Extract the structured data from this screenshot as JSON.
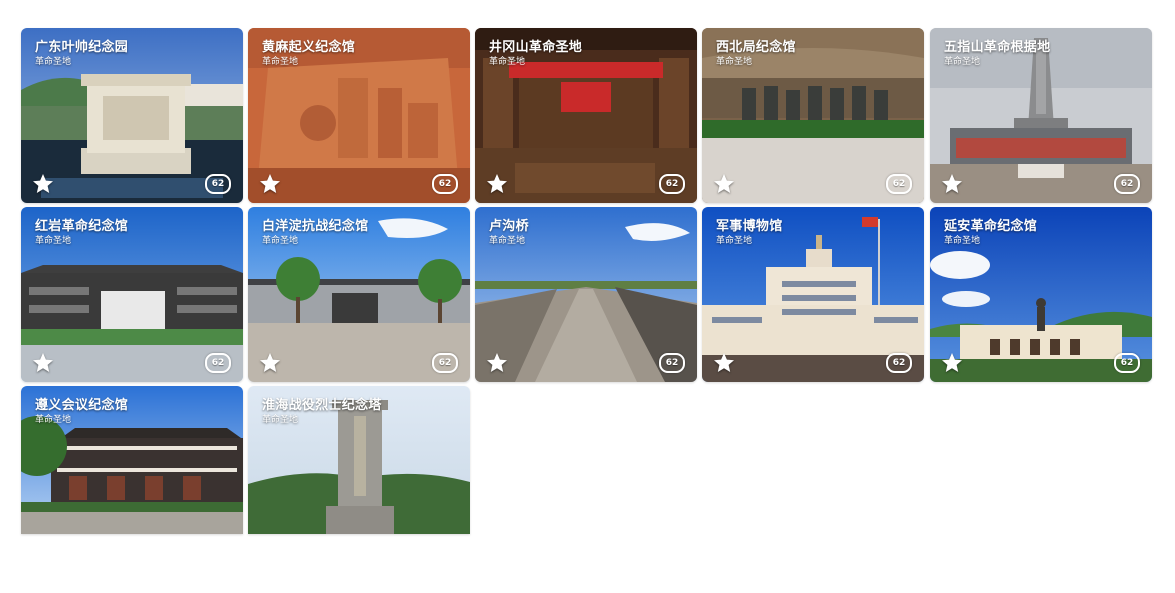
{
  "cards": [
    {
      "title": "广东叶帅纪念园",
      "subtitle": "革命圣地",
      "count": "62"
    },
    {
      "title": "黄麻起义纪念馆",
      "subtitle": "革命圣地",
      "count": "62"
    },
    {
      "title": "井冈山革命圣地",
      "subtitle": "革命圣地",
      "count": "62"
    },
    {
      "title": "西北局纪念馆",
      "subtitle": "革命圣地",
      "count": "62"
    },
    {
      "title": "五指山革命根据地",
      "subtitle": "革命圣地",
      "count": "62"
    },
    {
      "title": "红岩革命纪念馆",
      "subtitle": "革命圣地",
      "count": "62"
    },
    {
      "title": "白洋淀抗战纪念馆",
      "subtitle": "革命圣地",
      "count": "62"
    },
    {
      "title": "卢沟桥",
      "subtitle": "革命圣地",
      "count": "62"
    },
    {
      "title": "军事博物馆",
      "subtitle": "革命圣地",
      "count": "62"
    },
    {
      "title": "延安革命纪念馆",
      "subtitle": "革命圣地",
      "count": "62"
    },
    {
      "title": "遵义会议纪念馆",
      "subtitle": "革命圣地"
    },
    {
      "title": "淮海战役烈士纪念塔",
      "subtitle": "革命圣地"
    }
  ],
  "icons": {
    "favorite": "star-icon",
    "count_badge": "count-badge"
  },
  "colors": {
    "text": "#ffffff",
    "background": "#ffffff"
  }
}
